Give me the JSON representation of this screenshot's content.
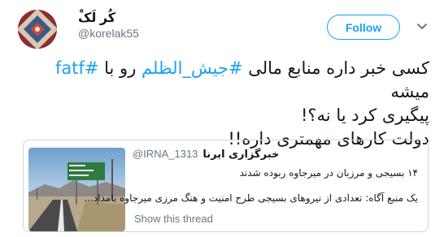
{
  "author": {
    "display_name": "کُر لَکْ",
    "handle": "@korelak55"
  },
  "actions": {
    "follow_label": "Follow"
  },
  "tweet": {
    "line1_pre": "کسی خبر داره منابع مالی ",
    "hashtag1": "#جیش_الظلم",
    "line1_mid": " رو با ",
    "hashtag2": "#fatf",
    "line1_post": " میشه",
    "line2": "پیگیری کرد یا نه؟!",
    "line3": "دولت کارهای مهمتری داره!!"
  },
  "quoted_tweet": {
    "handle": "@IRNA_1313",
    "name": "خبرگزاری ایرنا",
    "line1": "۱۴ بسیجی و مرزبان در میرجاوه ربوده شدند",
    "line2": "یک منبع آگاه: تعدادی از نیروهای بسیجی طرح امنیت و هنگ مرزی میرجاوه بامداد...",
    "show_thread": "Show this thread"
  },
  "colors": {
    "accent": "#1da1f2",
    "secondary_text": "#657786",
    "border": "#ccd6dd"
  },
  "icons": {
    "avatar": "carpet-pattern-avatar",
    "caret": "chevron-down-icon"
  }
}
